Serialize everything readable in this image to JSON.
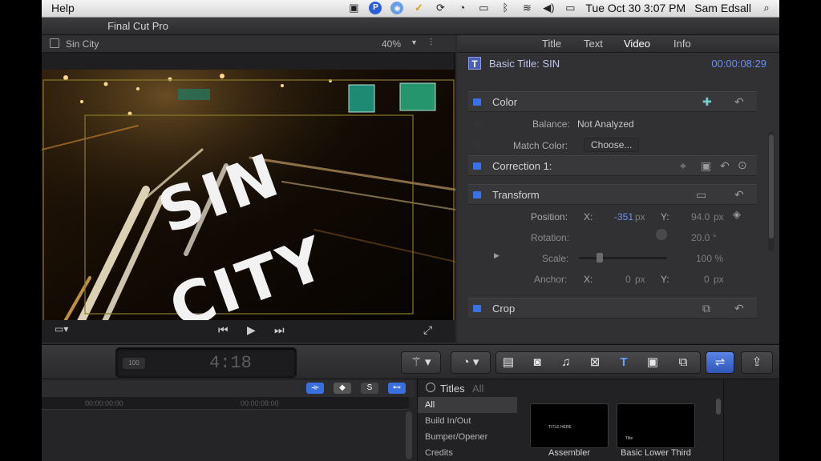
{
  "menubar": {
    "app_menu": "Help",
    "clock": "Tue Oct 30  3:07 PM",
    "user": "Sam Edsall",
    "icons": [
      "camera-icon",
      "p-icon",
      "globe-icon",
      "checkmark-icon",
      "sync-icon",
      "time-machine-icon",
      "display-icon",
      "bluetooth-icon",
      "wifi-icon",
      "volume-icon",
      "battery-icon",
      "spotlight-icon"
    ]
  },
  "window": {
    "title": "Final Cut Pro"
  },
  "viewer": {
    "clip_name": "Sin City",
    "zoom": "40%",
    "overlay_line1": "SIN",
    "overlay_line2": "CITY"
  },
  "inspector": {
    "tabs": [
      "Title",
      "Text",
      "Video",
      "Info"
    ],
    "active_tab": "Video",
    "clip_title": "Basic Title: SIN",
    "timecode": "00:00:08:29",
    "color": {
      "label": "Color",
      "balance_label": "Balance:",
      "balance_value": "Not Analyzed",
      "match_label": "Match Color:",
      "choose_button": "Choose..."
    },
    "correction": {
      "label": "Correction 1:"
    },
    "transform": {
      "label": "Transform",
      "position_label": "Position:",
      "x_label": "X:",
      "pos_x": "-351",
      "px1": "px",
      "y_label": "Y:",
      "pos_y": "94.0",
      "px2": "px",
      "rotation_label": "Rotation:",
      "rotation_value": "20.0 °",
      "scale_label": "Scale:",
      "scale_value": "100 %",
      "anchor_label": "Anchor:",
      "anchor_x_label": "X:",
      "anchor_x": "0",
      "anchor_px1": "px",
      "anchor_y_label": "Y:",
      "anchor_y": "0",
      "anchor_px2": "px"
    },
    "crop": {
      "label": "Crop"
    }
  },
  "toolbar": {
    "dashboard_badge": "100",
    "dashboard_timecode": "4:18"
  },
  "timeline": {
    "ruler_start": "00:00:00:00",
    "ruler_mark": "00:00:08:00"
  },
  "browser": {
    "title": "Titles",
    "scope": "All",
    "categories": [
      "All",
      "Build In/Out",
      "Bumper/Opener",
      "Credits"
    ],
    "thumbnails": [
      {
        "name": "Assembler",
        "caption": "TITLE HERE"
      },
      {
        "name": "Basic Lower Third",
        "caption": "Title"
      }
    ]
  },
  "colors": {
    "accent": "#3a72e6",
    "timecode": "#6a8ff0",
    "panel": "#313133"
  }
}
